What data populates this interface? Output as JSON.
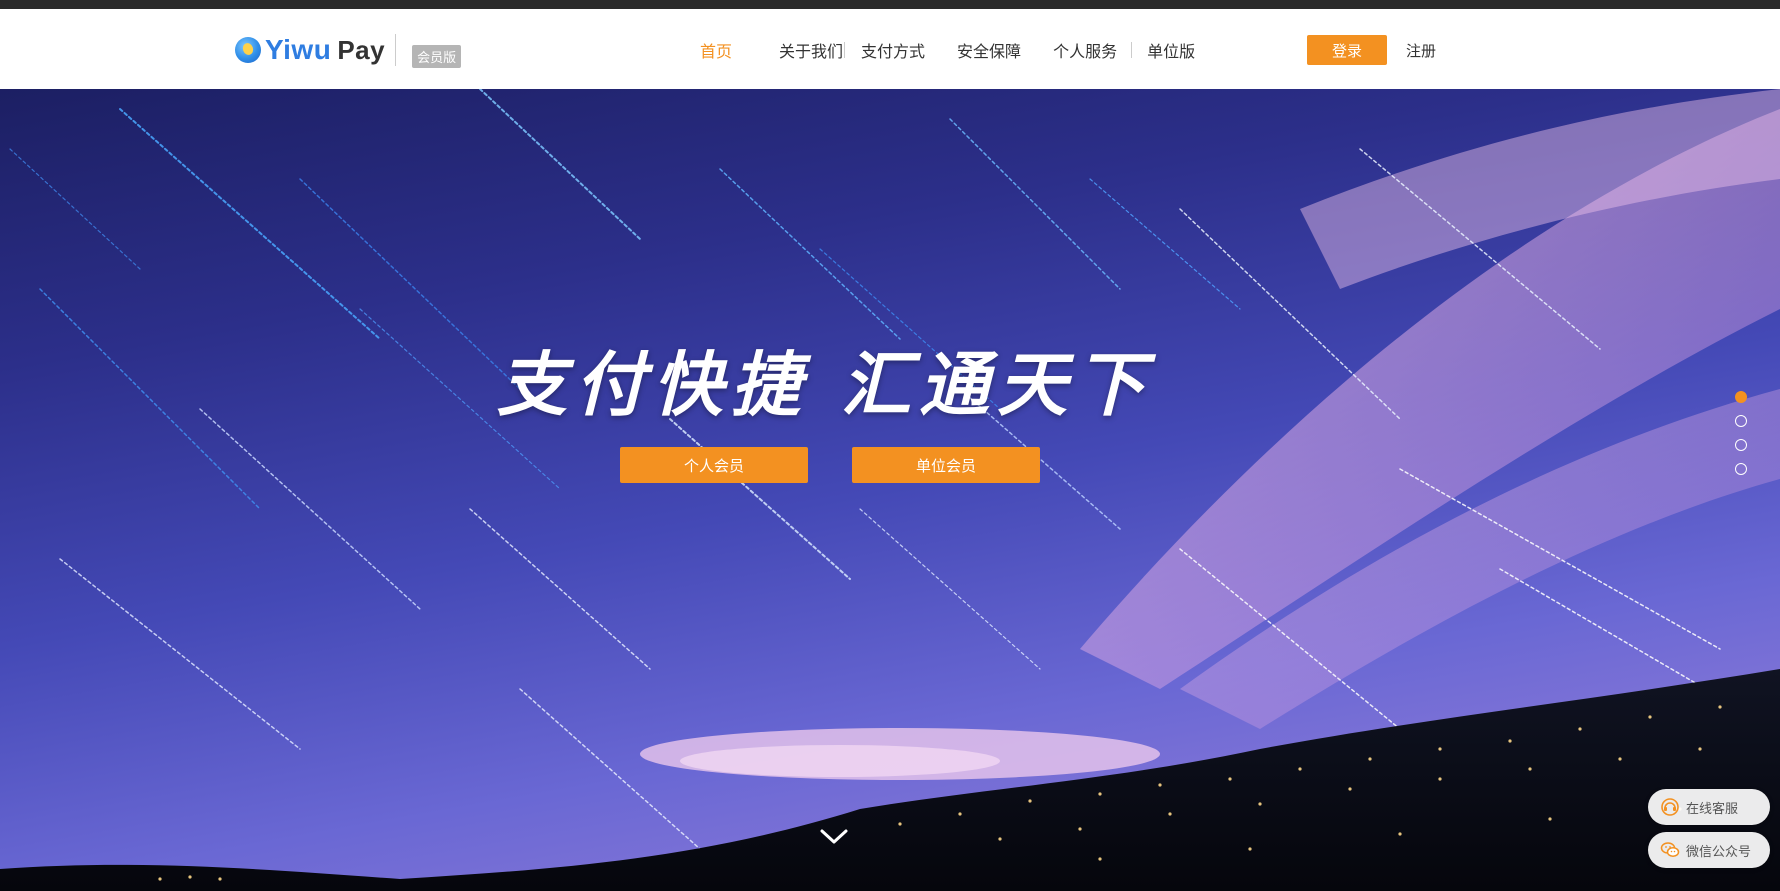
{
  "header": {
    "logo": {
      "brand_main": "Yiwu",
      "brand_pay": "Pay",
      "badge": "会员版"
    },
    "nav": [
      {
        "label": "首页",
        "active": true
      },
      {
        "label": "关于我们"
      },
      {
        "label": "支付方式"
      },
      {
        "label": "安全保障"
      },
      {
        "label": "个人服务"
      },
      {
        "label": "单位版"
      }
    ],
    "login_label": "登录",
    "register_label": "注册"
  },
  "hero": {
    "slogan": "支付快捷 汇通天下",
    "personal_member_label": "个人会员",
    "unit_member_label": "单位会员",
    "slides_total": 4,
    "active_slide": 1
  },
  "float_widgets": {
    "online_service_label": "在线客服",
    "wechat_label": "微信公众号"
  },
  "colors": {
    "accent": "#f39121",
    "brand_blue": "#2f7de1"
  }
}
